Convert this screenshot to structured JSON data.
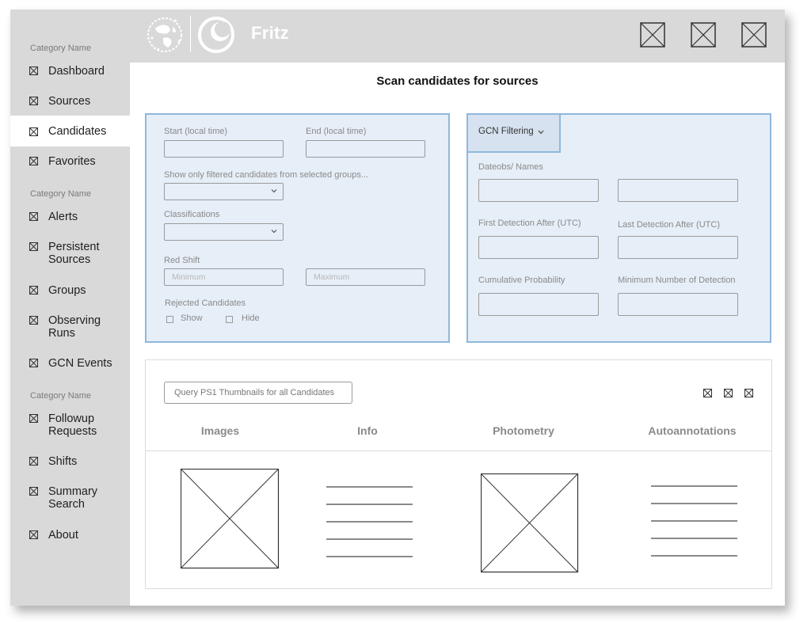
{
  "app": {
    "brand": "Fritz"
  },
  "sidebar": {
    "categories": [
      "Category Name",
      "Category Name",
      "Category Name"
    ],
    "items": [
      {
        "label": "Dashboard",
        "active": false
      },
      {
        "label": "Sources",
        "active": false
      },
      {
        "label": "Candidates",
        "active": true
      },
      {
        "label": "Favorites",
        "active": false
      },
      {
        "label": "Alerts",
        "active": false
      },
      {
        "label": "Persistent Sources",
        "active": false
      },
      {
        "label": "Groups",
        "active": false
      },
      {
        "label": "Observing Runs",
        "active": false
      },
      {
        "label": "GCN Events",
        "active": false
      },
      {
        "label": "Followup Requests",
        "active": false
      },
      {
        "label": "Shifts",
        "active": false
      },
      {
        "label": "Summary Search",
        "active": false
      },
      {
        "label": "About",
        "active": false
      }
    ]
  },
  "main": {
    "title": "Scan candidates for sources",
    "filters": {
      "start_label": "Start (local time)",
      "end_label": "End (local time)",
      "groups_label": "Show only filtered candidates from selected groups...",
      "classifications_label": "Classifications",
      "redshift_label": "Red Shift",
      "redshift_min_placeholder": "Minimum",
      "redshift_max_placeholder": "Maximum",
      "rejected_label": "Rejected Candidates",
      "show_label": "Show",
      "hide_label": "Hide"
    },
    "gcn": {
      "tab_label": "GCN Filtering",
      "dateobs_label": "Dateobs/ Names",
      "first_detection_label": "First Detection After (UTC)",
      "last_detection_label": "Last Detection After (UTC)",
      "cumulative_probability_label": "Cumulative Probability",
      "min_detections_label": "Minimum Number of Detection"
    },
    "results": {
      "query_button": "Query PS1 Thumbnails for all Candidates",
      "columns": [
        "Images",
        "Info",
        "Photometry",
        "Autoannotations"
      ]
    }
  },
  "colors": {
    "panel_bg": "#e6eef7",
    "panel_border": "#8fb8dc",
    "sidebar_bg": "#d9d9d9"
  },
  "icons": [
    "placeholder-x-icon",
    "globe-logo-icon",
    "moon-logo-icon",
    "chevron-down-icon"
  ]
}
